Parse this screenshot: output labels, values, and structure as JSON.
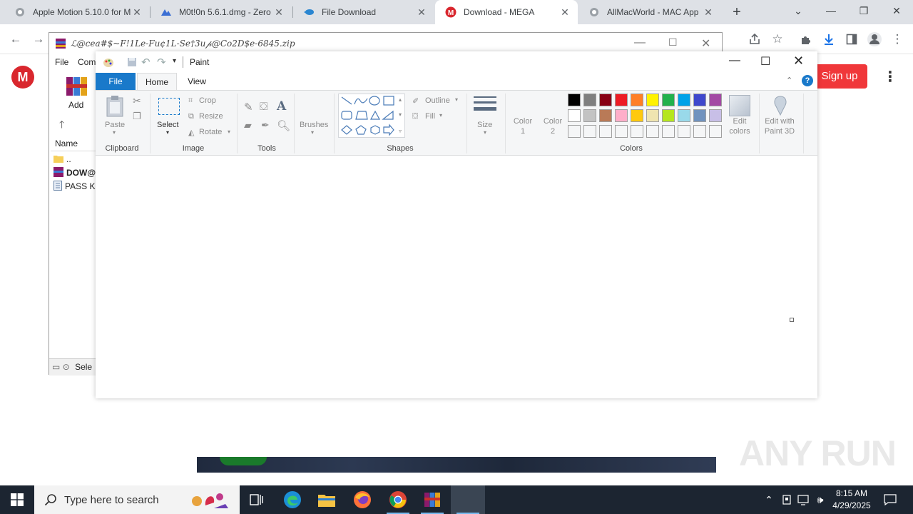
{
  "browser": {
    "tabs": [
      {
        "label": "Apple Motion 5.10.0 for M",
        "icon": "apple-icon"
      },
      {
        "label": "M0t!0n 5.6.1.dmg - Zero",
        "icon": "cloud-icon"
      },
      {
        "label": "File Download",
        "icon": "file-download-icon"
      },
      {
        "label": "Download - MEGA",
        "icon": "mega-icon"
      },
      {
        "label": "AllMacWorld - MAC App",
        "icon": "apple-icon"
      }
    ],
    "active_tab": 3,
    "new_tab": "+"
  },
  "mega": {
    "logo": "M",
    "signup": "Sign up",
    "watermark": "ANY RUN"
  },
  "winrar": {
    "title": "ℒ@cea#$~F!1Le-Fu¢1L-Se†3u𝓅@Co2D$e-6845.zip",
    "menu": [
      "File",
      "Com"
    ],
    "add_label": "Add",
    "column_name": "Name",
    "rows": [
      "..",
      "DOW@I",
      "PASS KE"
    ],
    "status": "Sele"
  },
  "paint": {
    "title": "Paint",
    "file_tab": "File",
    "tabs": [
      "Home",
      "View"
    ],
    "clipboard": {
      "paste": "Paste",
      "label": "Clipboard"
    },
    "image": {
      "select": "Select",
      "crop": "Crop",
      "resize": "Resize",
      "rotate": "Rotate",
      "label": "Image"
    },
    "tools": {
      "label": "Tools"
    },
    "brushes": {
      "label": "Brushes"
    },
    "shapes": {
      "outline": "Outline",
      "fill": "Fill",
      "label": "Shapes"
    },
    "size": {
      "label": "Size"
    },
    "colors": {
      "color1": "Color\n1",
      "color1_a": "Color",
      "color1_b": "1",
      "color2_a": "Color",
      "color2_b": "2",
      "edit_a": "Edit",
      "edit_b": "colors",
      "paint3d_a": "Edit with",
      "paint3d_b": "Paint 3D",
      "label": "Colors",
      "palette_row1": [
        "#000000",
        "#7f7f7f",
        "#880015",
        "#ed1c24",
        "#ff7f27",
        "#fff200",
        "#22b14c",
        "#00a2e8",
        "#3f48cc",
        "#a349a4"
      ],
      "palette_row2": [
        "#ffffff",
        "#c3c3c3",
        "#b97a57",
        "#ffaec9",
        "#ffc90e",
        "#efe4b0",
        "#b5e61d",
        "#99d9ea",
        "#7092be",
        "#c8bfe7"
      ]
    }
  },
  "taskbar": {
    "search_placeholder": "Type here to search",
    "time": "8:15 AM",
    "date": "4/29/2025"
  }
}
